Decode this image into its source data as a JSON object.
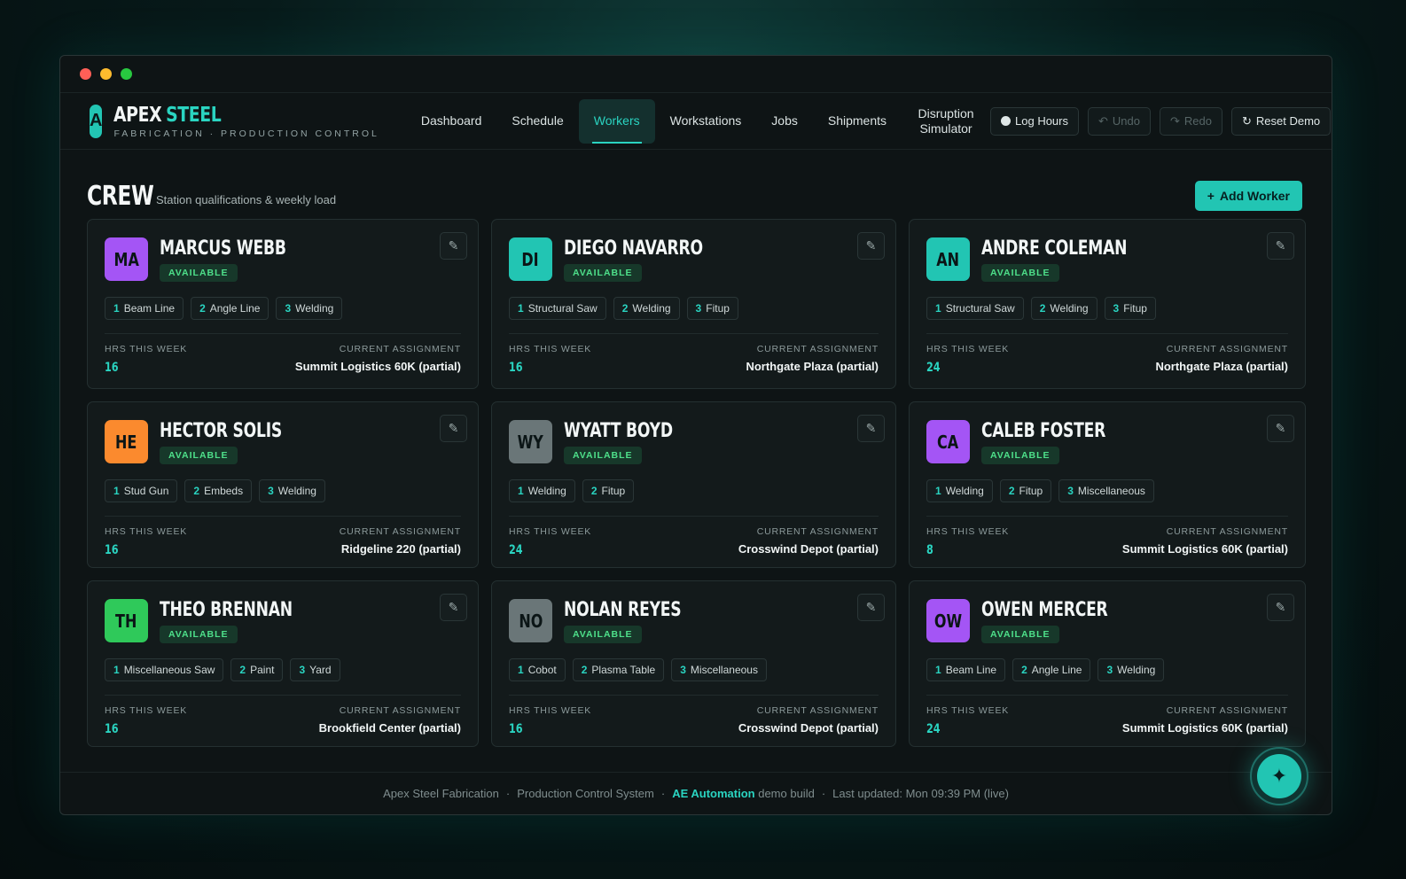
{
  "app": {
    "logo_letter": "A",
    "brand_word1": "APEX",
    "brand_word2": "STEEL",
    "subtitle": "FABRICATION · PRODUCTION CONTROL"
  },
  "nav": [
    {
      "label": "Dashboard"
    },
    {
      "label": "Schedule"
    },
    {
      "label": "Workers",
      "active": true
    },
    {
      "label": "Workstations"
    },
    {
      "label": "Jobs"
    },
    {
      "label": "Shipments"
    },
    {
      "label": "Disruption Simulator"
    }
  ],
  "actions": {
    "log_hours": "Log Hours",
    "undo": "Undo",
    "redo": "Redo",
    "reset": "Reset Demo"
  },
  "page": {
    "title": "CREW",
    "subtitle": "Station qualifications & weekly load",
    "add_button": "Add Worker",
    "add_icon": "+"
  },
  "labels": {
    "hours": "HRS THIS WEEK",
    "assignment": "CURRENT ASSIGNMENT"
  },
  "workers": [
    {
      "initials": "MA",
      "name": "MARCUS WEBB",
      "status": "AVAILABLE",
      "color": "#a455f5",
      "quals": [
        "Beam Line",
        "Angle Line",
        "Welding"
      ],
      "hours": "16",
      "assignment": "Summit Logistics 60K (partial)"
    },
    {
      "initials": "DI",
      "name": "DIEGO NAVARRO",
      "status": "AVAILABLE",
      "color": "#22c5b3",
      "quals": [
        "Structural Saw",
        "Welding",
        "Fitup"
      ],
      "hours": "16",
      "assignment": "Northgate Plaza (partial)"
    },
    {
      "initials": "AN",
      "name": "ANDRE COLEMAN",
      "status": "AVAILABLE",
      "color": "#22c5b3",
      "quals": [
        "Structural Saw",
        "Welding",
        "Fitup"
      ],
      "hours": "24",
      "assignment": "Northgate Plaza (partial)"
    },
    {
      "initials": "HE",
      "name": "HECTOR SOLIS",
      "status": "AVAILABLE",
      "color": "#fb8a2e",
      "quals": [
        "Stud Gun",
        "Embeds",
        "Welding"
      ],
      "hours": "16",
      "assignment": "Ridgeline 220 (partial)"
    },
    {
      "initials": "WY",
      "name": "WYATT BOYD",
      "status": "AVAILABLE",
      "color": "#6a7678",
      "quals": [
        "Welding",
        "Fitup"
      ],
      "hours": "24",
      "assignment": "Crosswind Depot (partial)"
    },
    {
      "initials": "CA",
      "name": "CALEB FOSTER",
      "status": "AVAILABLE",
      "color": "#a455f5",
      "quals": [
        "Welding",
        "Fitup",
        "Miscellaneous"
      ],
      "hours": "8",
      "assignment": "Summit Logistics 60K (partial)"
    },
    {
      "initials": "TH",
      "name": "THEO BRENNAN",
      "status": "AVAILABLE",
      "color": "#2fc95a",
      "quals": [
        "Miscellaneous Saw",
        "Paint",
        "Yard"
      ],
      "hours": "16",
      "assignment": "Brookfield Center (partial)"
    },
    {
      "initials": "NO",
      "name": "NOLAN REYES",
      "status": "AVAILABLE",
      "color": "#6a7678",
      "quals": [
        "Cobot",
        "Plasma Table",
        "Miscellaneous"
      ],
      "hours": "16",
      "assignment": "Crosswind Depot (partial)"
    },
    {
      "initials": "OW",
      "name": "OWEN MERCER",
      "status": "AVAILABLE",
      "color": "#a455f5",
      "quals": [
        "Beam Line",
        "Angle Line",
        "Welding"
      ],
      "hours": "24",
      "assignment": "Summit Logistics 60K (partial)"
    }
  ],
  "footer": {
    "part1": "Apex Steel Fabrication",
    "part2": "Production Control System",
    "accent": "AE Automation",
    "part3": "demo build",
    "part4": "Last updated: Mon 09:39 PM (live)",
    "sep": "·"
  },
  "fab_icon": "✦",
  "edit_icon": "✎"
}
